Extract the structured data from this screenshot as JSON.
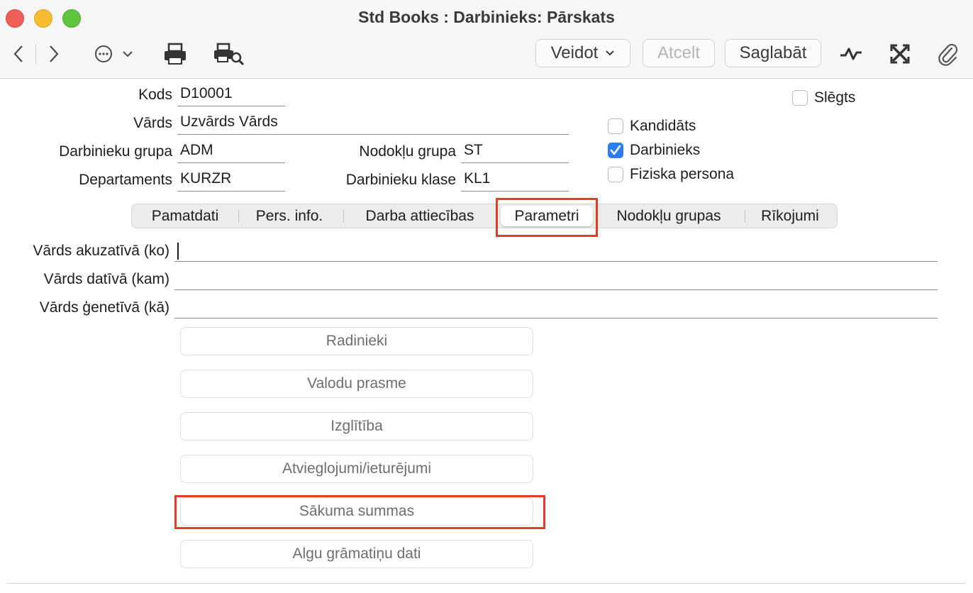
{
  "window": {
    "title": "Std Books : Darbinieks: Pārskats"
  },
  "toolbar": {
    "back_icon": "chevron-left-icon",
    "forward_icon": "chevron-right-icon",
    "more_icon": "ellipsis-circle-icon",
    "print_icon": "printer-icon",
    "preview_icon": "print-preview-icon",
    "create_label": "Veidot",
    "cancel_label": "Atcelt",
    "save_label": "Saglabāt",
    "activity_icon": "activity-icon",
    "expand_icon": "expand-icon",
    "attach_icon": "paperclip-icon"
  },
  "form": {
    "code": {
      "label": "Kods",
      "value": "D10001"
    },
    "name": {
      "label": "Vārds",
      "value": "Uzvārds Vārds"
    },
    "employee_group": {
      "label": "Darbinieku grupa",
      "value": "ADM"
    },
    "tax_group": {
      "label": "Nodokļu grupa",
      "value": "ST"
    },
    "department": {
      "label": "Departaments",
      "value": "KURZR"
    },
    "employee_class": {
      "label": "Darbinieku klase",
      "value": "KL1"
    },
    "closed": {
      "label": "Slēgts",
      "checked": false
    },
    "candidate": {
      "label": "Kandidāts",
      "checked": false
    },
    "employee": {
      "label": "Darbinieks",
      "checked": true
    },
    "natural_person": {
      "label": "Fiziska persona",
      "checked": false
    }
  },
  "tabs": [
    {
      "label": "Pamatdati",
      "active": false
    },
    {
      "label": "Pers. info.",
      "active": false
    },
    {
      "label": "Darba attiecības",
      "active": false
    },
    {
      "label": "Parametri",
      "active": true
    },
    {
      "label": "Nodokļu grupas",
      "active": false
    },
    {
      "label": "Rīkojumi",
      "active": false
    }
  ],
  "params": {
    "accusative": {
      "label": "Vārds akuzatīvā (ko)",
      "value": ""
    },
    "dative": {
      "label": "Vārds datīvā (kam)",
      "value": ""
    },
    "genitive": {
      "label": "Vārds ģenetīvā (kā)",
      "value": ""
    }
  },
  "buttons": [
    "Radinieki",
    "Valodu prasme",
    "Izglītība",
    "Atvieglojumi/ieturējumi",
    "Sākuma summas",
    "Algu grāmatiņu dati"
  ],
  "colors": {
    "highlight": "#e23d28",
    "checkbox_on": "#2d7cf6"
  }
}
